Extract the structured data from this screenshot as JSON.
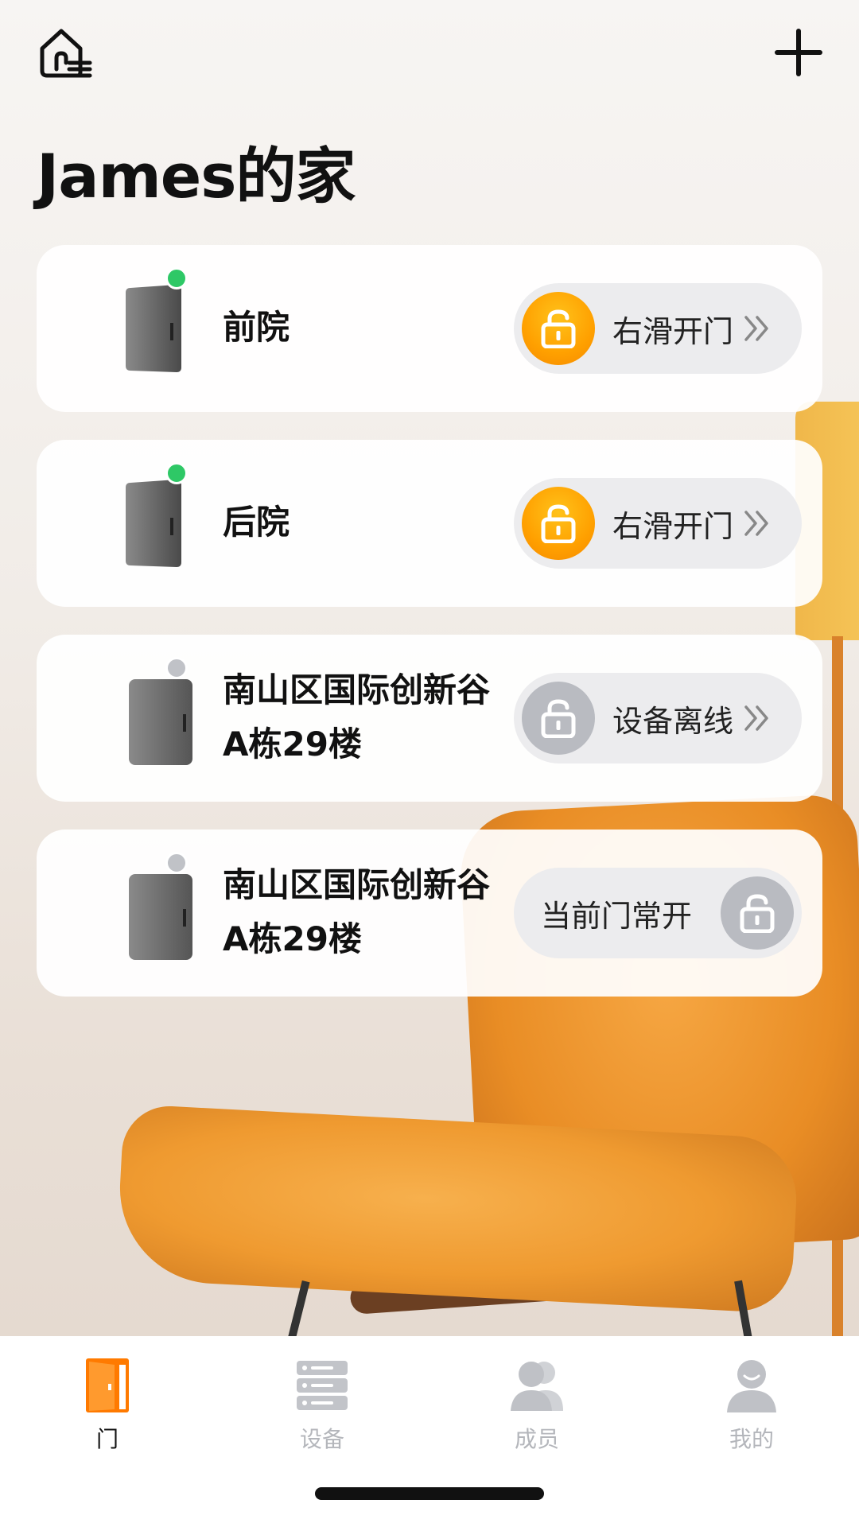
{
  "header": {
    "home_icon": "home-menu-icon",
    "add_icon": "plus-icon",
    "title": "James的家"
  },
  "doors": [
    {
      "name": "前院",
      "status": "online",
      "action_label": "右滑开门",
      "lock_color": "#ffa000"
    },
    {
      "name": "后院",
      "status": "online",
      "action_label": "右滑开门",
      "lock_color": "#ffa000"
    },
    {
      "name": "南山区国际创新谷A栋29楼",
      "status": "offline",
      "action_label": "设备离线",
      "lock_color": "#b9bbc1"
    },
    {
      "name": "南山区国际创新谷A栋29楼",
      "status": "offline",
      "action_label": "当前门常开",
      "lock_color": "#b9bbc1"
    }
  ],
  "tabbar": {
    "tabs": [
      {
        "label": "门",
        "icon": "door-icon",
        "active": true
      },
      {
        "label": "设备",
        "icon": "devices-icon",
        "active": false
      },
      {
        "label": "成员",
        "icon": "members-icon",
        "active": false
      },
      {
        "label": "我的",
        "icon": "profile-icon",
        "active": false
      }
    ]
  },
  "colors": {
    "accent": "#ff7a00",
    "online": "#2ec866",
    "offline": "#c0c2c7"
  }
}
